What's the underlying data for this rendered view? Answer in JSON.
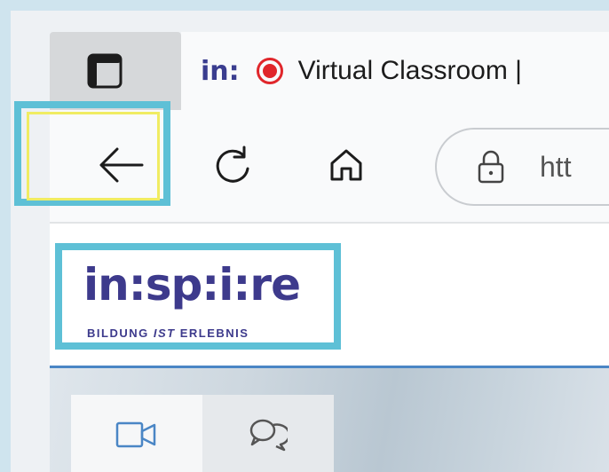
{
  "browser": {
    "tab": {
      "favicon_text": "in:",
      "title": "Virtual Classroom |"
    },
    "address_bar": {
      "url_visible": "htt"
    }
  },
  "site": {
    "logo": {
      "main": "in:sp:i:re",
      "tagline_prefix": "BILDUNG ",
      "tagline_italic": "IST",
      "tagline_suffix": " ERLEBNIS"
    }
  },
  "colors": {
    "highlight": "#5ec0d6",
    "highlight_inner": "#f0ec62",
    "brand": "#3d3a8c",
    "record": "#e0262b"
  },
  "icons": [
    "tab-actions-icon",
    "record-icon",
    "back-arrow-icon",
    "reload-icon",
    "home-icon",
    "lock-icon",
    "video-icon",
    "chat-icon"
  ]
}
